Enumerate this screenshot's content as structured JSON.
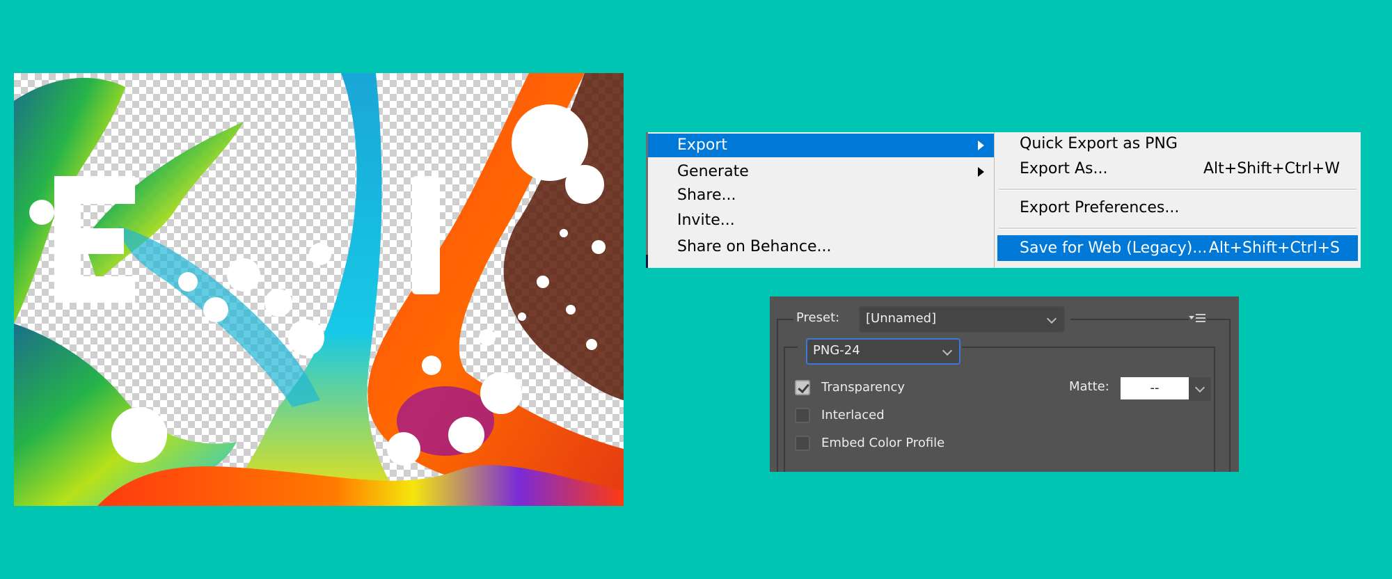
{
  "artwork": {
    "description": "Fluid paint artwork with transparent background (checkerboard)",
    "letters": [
      "E",
      "I"
    ],
    "transparent_bg_colors": [
      "#ffffff",
      "#cfcfcf"
    ]
  },
  "main_menu": {
    "items": [
      {
        "label": "Export",
        "has_submenu": true,
        "highlighted": true
      },
      {
        "label": "Generate",
        "has_submenu": true,
        "highlighted": false
      },
      {
        "label": "Share...",
        "has_submenu": false,
        "highlighted": false
      },
      {
        "label": "Invite...",
        "has_submenu": false,
        "highlighted": false
      },
      {
        "label": "Share on Behance...",
        "has_submenu": false,
        "highlighted": false
      }
    ]
  },
  "export_submenu": {
    "items": [
      {
        "label": "Quick Export as PNG",
        "shortcut": "",
        "highlighted": false
      },
      {
        "label": "Export As...",
        "shortcut": "Alt+Shift+Ctrl+W",
        "highlighted": false
      },
      {
        "label": "Export Preferences...",
        "shortcut": "",
        "highlighted": false
      },
      {
        "label": "Save for Web (Legacy)...",
        "shortcut": "Alt+Shift+Ctrl+S",
        "highlighted": true
      }
    ]
  },
  "save_for_web_dialog": {
    "preset_label": "Preset:",
    "preset_value": "[Unnamed]",
    "format_value": "PNG-24",
    "options": [
      {
        "label": "Transparency",
        "checked": true
      },
      {
        "label": "Interlaced",
        "checked": false
      },
      {
        "label": "Embed Color Profile",
        "checked": false
      }
    ],
    "matte_label": "Matte:",
    "matte_value": "--"
  },
  "colors": {
    "background": "#00c5b2",
    "menu_bg": "#f0f0f0",
    "highlight": "#0078d7",
    "dialog_bg": "#535353",
    "focus_border": "#3c78d8"
  }
}
